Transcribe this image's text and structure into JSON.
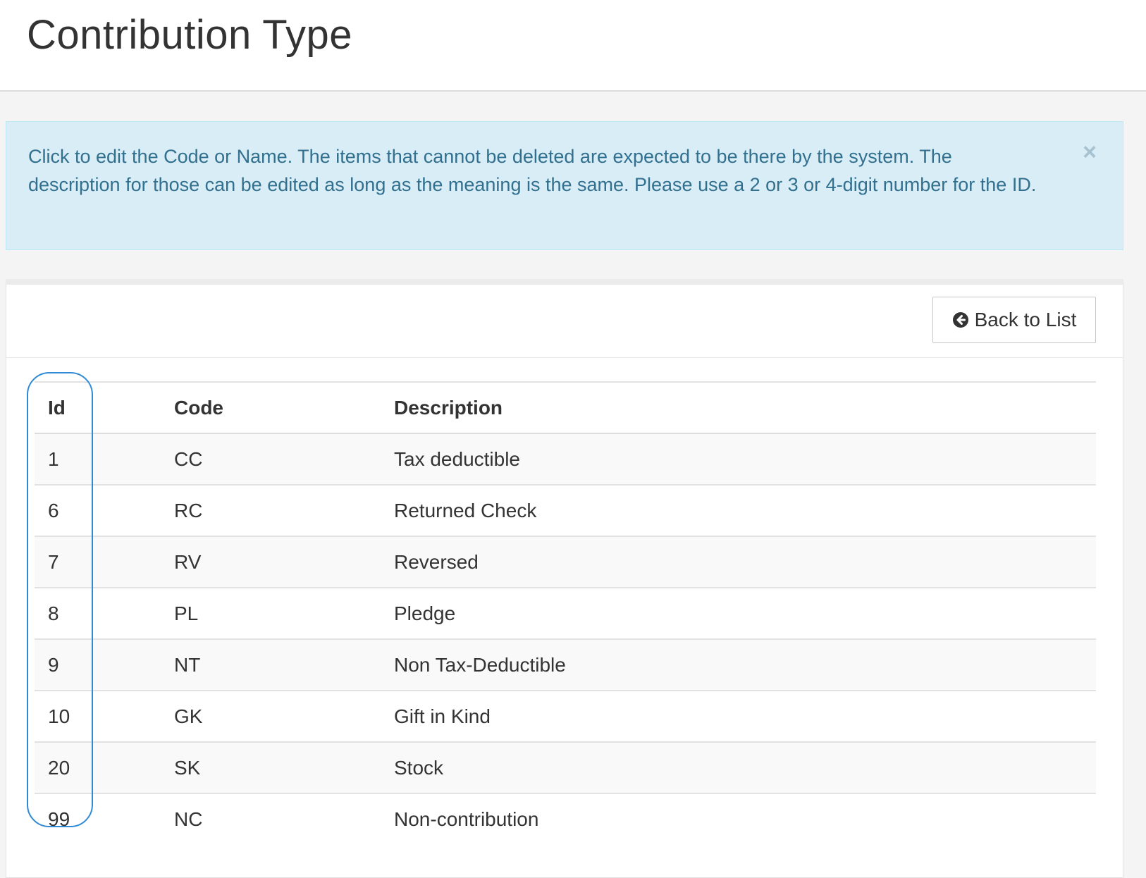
{
  "header": {
    "title": "Contribution Type"
  },
  "alert": {
    "message": "Click to edit the Code or Name. The items that cannot be deleted are expected to be there by the system. The description for those can be edited as long as the meaning is the same. Please use a 2 or 3 or 4-digit number for the ID.",
    "close_label": "×"
  },
  "toolbar": {
    "back_label": "Back to List",
    "back_icon": "arrow-circle-left-icon"
  },
  "table": {
    "columns": [
      "Id",
      "Code",
      "Description"
    ],
    "rows": [
      {
        "id": "1",
        "code": "CC",
        "description": "Tax deductible"
      },
      {
        "id": "6",
        "code": "RC",
        "description": "Returned Check"
      },
      {
        "id": "7",
        "code": "RV",
        "description": "Reversed"
      },
      {
        "id": "8",
        "code": "PL",
        "description": "Pledge"
      },
      {
        "id": "9",
        "code": "NT",
        "description": "Non Tax-Deductible"
      },
      {
        "id": "10",
        "code": "GK",
        "description": "Gift in Kind"
      },
      {
        "id": "20",
        "code": "SK",
        "description": "Stock"
      },
      {
        "id": "99",
        "code": "NC",
        "description": "Non-contribution"
      }
    ]
  },
  "colors": {
    "alert_background": "#d9edf7",
    "alert_text": "#31708f",
    "highlight_outline": "#2f8ad6"
  }
}
